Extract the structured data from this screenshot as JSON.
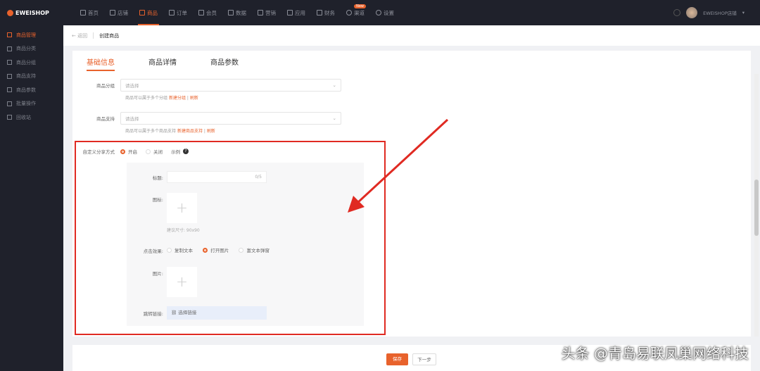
{
  "brand": "EWEISHOP",
  "nav": [
    {
      "label": "首页"
    },
    {
      "label": "店铺"
    },
    {
      "label": "商品"
    },
    {
      "label": "订单"
    },
    {
      "label": "会员"
    },
    {
      "label": "数据"
    },
    {
      "label": "营销"
    },
    {
      "label": "应用"
    },
    {
      "label": "财务"
    },
    {
      "label": "渠道",
      "badge": "New"
    },
    {
      "label": "设置"
    }
  ],
  "user": {
    "name": "EWEISHOP店铺"
  },
  "sidebar": [
    {
      "label": "商品管理"
    },
    {
      "label": "商品分类"
    },
    {
      "label": "商品分组"
    },
    {
      "label": "商品支持"
    },
    {
      "label": "商品参数"
    },
    {
      "label": "批量操作"
    },
    {
      "label": "回收站"
    }
  ],
  "breadcrumb": {
    "back": "← 返回",
    "current": "创建商品"
  },
  "tabs": [
    {
      "label": "基础信息"
    },
    {
      "label": "商品详情"
    },
    {
      "label": "商品参数"
    }
  ],
  "form": {
    "group": {
      "label": "商品分组",
      "placeholder": "请选择",
      "hint": "商品可以属于多个分组",
      "create": "新建分组",
      "divider": "|",
      "refresh": "刷新"
    },
    "support": {
      "label": "商品支持",
      "placeholder": "请选择",
      "hint": "商品可以属于多个商品支持",
      "create": "新建商品支持",
      "divider": "|",
      "refresh": "刷新"
    },
    "share": {
      "label": "自定义分享方式",
      "options": [
        "开启",
        "关闭"
      ],
      "example": "示例",
      "help": "?"
    },
    "panel": {
      "title_label": "标题:",
      "title_count": "0/5",
      "icon_label": "图标:",
      "icon_hint": "建议尺寸: 90x90",
      "click_label": "点击效果:",
      "click_options": [
        "复制文本",
        "打开图片",
        "富文本弹窗"
      ],
      "image_label": "图片:",
      "link_label": "跳转链接:",
      "link_button": "选择链接",
      "plus": "+"
    }
  },
  "footer": {
    "save": "保存",
    "next": "下一步"
  },
  "watermark": "头条 @青岛易联凤巢网络科技"
}
